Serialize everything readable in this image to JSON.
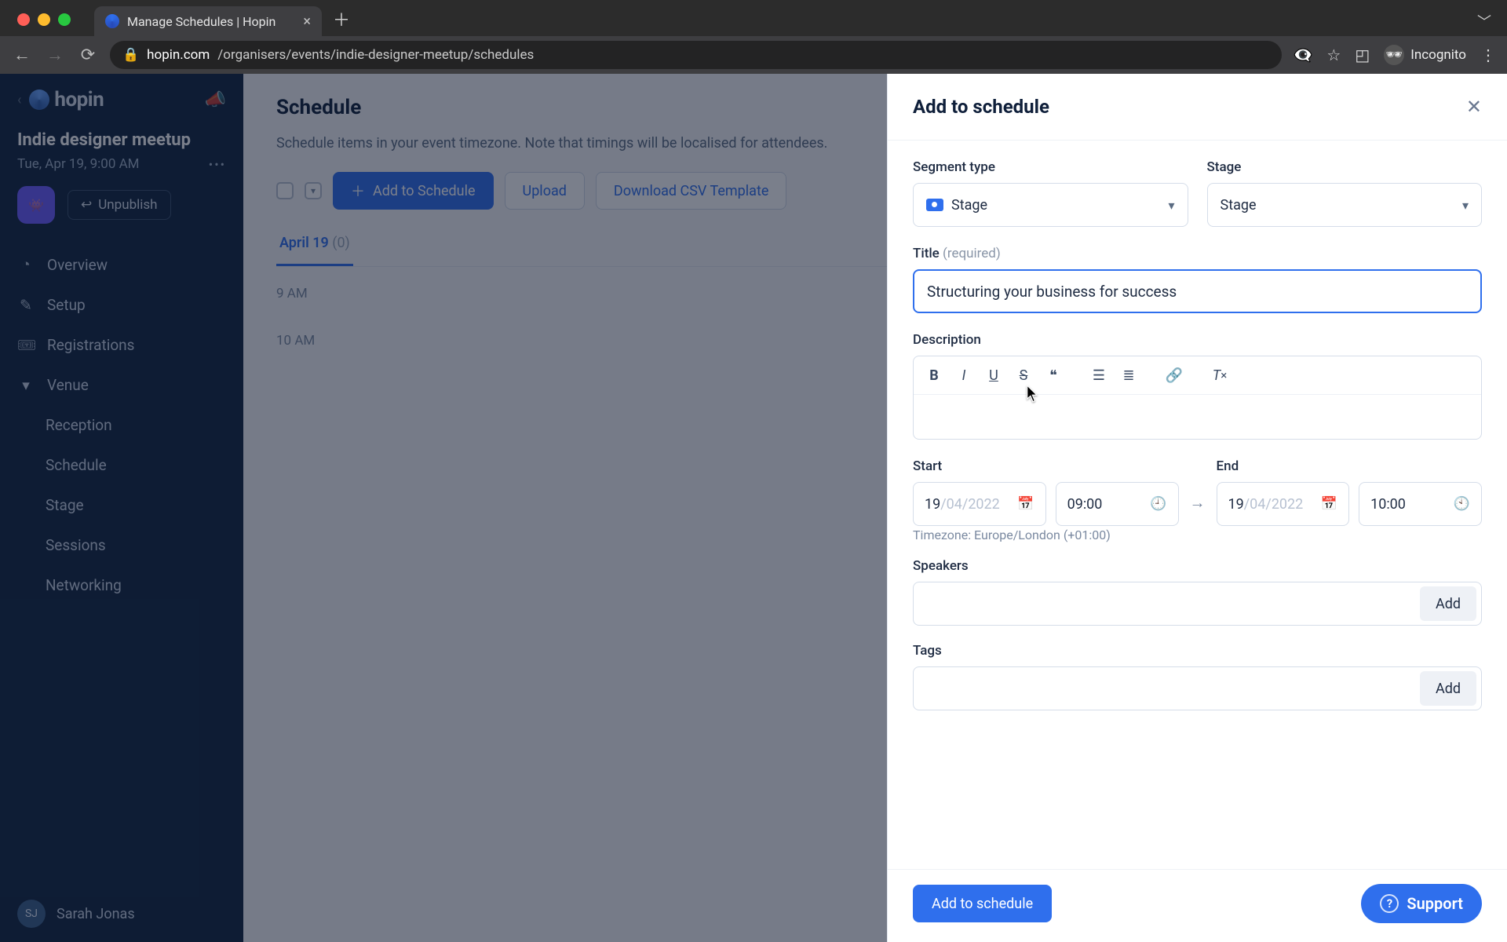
{
  "browser": {
    "tab_title": "Manage Schedules | Hopin",
    "url_host": "hopin.com",
    "url_path": "/organisers/events/indie-designer-meetup/schedules",
    "incognito_label": "Incognito"
  },
  "sidebar": {
    "brand": "hopin",
    "event_name": "Indie designer meetup",
    "event_date": "Tue, Apr 19, 9:00 AM",
    "unpublish_label": "Unpublish",
    "nav": {
      "overview": "Overview",
      "setup": "Setup",
      "registrations": "Registrations",
      "venue": "Venue",
      "reception": "Reception",
      "schedule": "Schedule",
      "stage": "Stage",
      "sessions": "Sessions",
      "networking": "Networking"
    },
    "user": {
      "initials": "SJ",
      "name": "Sarah Jonas"
    }
  },
  "main": {
    "heading": "Schedule",
    "hint": "Schedule items in your event timezone. Note that timings will be localised for attendees.",
    "toolbar": {
      "add": "Add to Schedule",
      "upload": "Upload",
      "download": "Download CSV Template"
    },
    "tab": {
      "label": "April 19",
      "count": "(0)"
    },
    "times": {
      "t9": "9 AM",
      "t10": "10 AM"
    }
  },
  "panel": {
    "title": "Add to schedule",
    "segment_type_label": "Segment type",
    "segment_type_value": "Stage",
    "stage_label": "Stage",
    "stage_value": "Stage",
    "title_label": "Title",
    "title_required": "(required)",
    "title_value": "Structuring your business for success",
    "description_label": "Description",
    "start_label": "Start",
    "end_label": "End",
    "start_date_day": "19",
    "start_date_rest": "/04/2022",
    "end_date_day": "19",
    "end_date_rest": "/04/2022",
    "start_time": "09:00",
    "end_time": "10:00",
    "timezone": "Timezone: Europe/London (+01:00)",
    "speakers_label": "Speakers",
    "tags_label": "Tags",
    "add_chip": "Add",
    "submit": "Add to schedule",
    "support": "Support"
  }
}
